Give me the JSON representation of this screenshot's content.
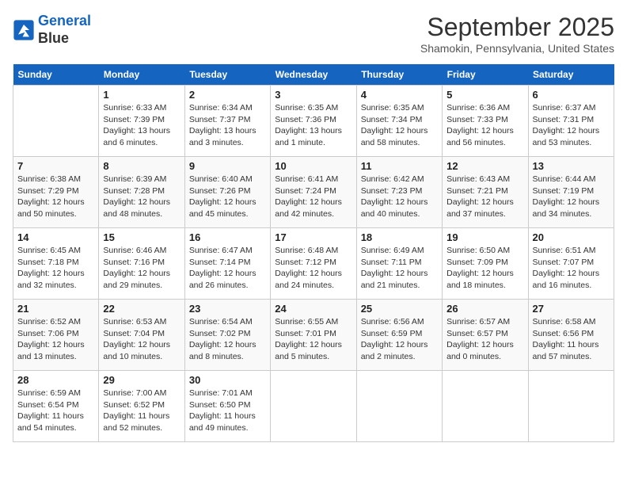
{
  "logo": {
    "line1": "General",
    "line2": "Blue"
  },
  "title": "September 2025",
  "subtitle": "Shamokin, Pennsylvania, United States",
  "days_of_week": [
    "Sunday",
    "Monday",
    "Tuesday",
    "Wednesday",
    "Thursday",
    "Friday",
    "Saturday"
  ],
  "weeks": [
    [
      {
        "day": "",
        "info": ""
      },
      {
        "day": "1",
        "info": "Sunrise: 6:33 AM\nSunset: 7:39 PM\nDaylight: 13 hours\nand 6 minutes."
      },
      {
        "day": "2",
        "info": "Sunrise: 6:34 AM\nSunset: 7:37 PM\nDaylight: 13 hours\nand 3 minutes."
      },
      {
        "day": "3",
        "info": "Sunrise: 6:35 AM\nSunset: 7:36 PM\nDaylight: 13 hours\nand 1 minute."
      },
      {
        "day": "4",
        "info": "Sunrise: 6:35 AM\nSunset: 7:34 PM\nDaylight: 12 hours\nand 58 minutes."
      },
      {
        "day": "5",
        "info": "Sunrise: 6:36 AM\nSunset: 7:33 PM\nDaylight: 12 hours\nand 56 minutes."
      },
      {
        "day": "6",
        "info": "Sunrise: 6:37 AM\nSunset: 7:31 PM\nDaylight: 12 hours\nand 53 minutes."
      }
    ],
    [
      {
        "day": "7",
        "info": "Sunrise: 6:38 AM\nSunset: 7:29 PM\nDaylight: 12 hours\nand 50 minutes."
      },
      {
        "day": "8",
        "info": "Sunrise: 6:39 AM\nSunset: 7:28 PM\nDaylight: 12 hours\nand 48 minutes."
      },
      {
        "day": "9",
        "info": "Sunrise: 6:40 AM\nSunset: 7:26 PM\nDaylight: 12 hours\nand 45 minutes."
      },
      {
        "day": "10",
        "info": "Sunrise: 6:41 AM\nSunset: 7:24 PM\nDaylight: 12 hours\nand 42 minutes."
      },
      {
        "day": "11",
        "info": "Sunrise: 6:42 AM\nSunset: 7:23 PM\nDaylight: 12 hours\nand 40 minutes."
      },
      {
        "day": "12",
        "info": "Sunrise: 6:43 AM\nSunset: 7:21 PM\nDaylight: 12 hours\nand 37 minutes."
      },
      {
        "day": "13",
        "info": "Sunrise: 6:44 AM\nSunset: 7:19 PM\nDaylight: 12 hours\nand 34 minutes."
      }
    ],
    [
      {
        "day": "14",
        "info": "Sunrise: 6:45 AM\nSunset: 7:18 PM\nDaylight: 12 hours\nand 32 minutes."
      },
      {
        "day": "15",
        "info": "Sunrise: 6:46 AM\nSunset: 7:16 PM\nDaylight: 12 hours\nand 29 minutes."
      },
      {
        "day": "16",
        "info": "Sunrise: 6:47 AM\nSunset: 7:14 PM\nDaylight: 12 hours\nand 26 minutes."
      },
      {
        "day": "17",
        "info": "Sunrise: 6:48 AM\nSunset: 7:12 PM\nDaylight: 12 hours\nand 24 minutes."
      },
      {
        "day": "18",
        "info": "Sunrise: 6:49 AM\nSunset: 7:11 PM\nDaylight: 12 hours\nand 21 minutes."
      },
      {
        "day": "19",
        "info": "Sunrise: 6:50 AM\nSunset: 7:09 PM\nDaylight: 12 hours\nand 18 minutes."
      },
      {
        "day": "20",
        "info": "Sunrise: 6:51 AM\nSunset: 7:07 PM\nDaylight: 12 hours\nand 16 minutes."
      }
    ],
    [
      {
        "day": "21",
        "info": "Sunrise: 6:52 AM\nSunset: 7:06 PM\nDaylight: 12 hours\nand 13 minutes."
      },
      {
        "day": "22",
        "info": "Sunrise: 6:53 AM\nSunset: 7:04 PM\nDaylight: 12 hours\nand 10 minutes."
      },
      {
        "day": "23",
        "info": "Sunrise: 6:54 AM\nSunset: 7:02 PM\nDaylight: 12 hours\nand 8 minutes."
      },
      {
        "day": "24",
        "info": "Sunrise: 6:55 AM\nSunset: 7:01 PM\nDaylight: 12 hours\nand 5 minutes."
      },
      {
        "day": "25",
        "info": "Sunrise: 6:56 AM\nSunset: 6:59 PM\nDaylight: 12 hours\nand 2 minutes."
      },
      {
        "day": "26",
        "info": "Sunrise: 6:57 AM\nSunset: 6:57 PM\nDaylight: 12 hours\nand 0 minutes."
      },
      {
        "day": "27",
        "info": "Sunrise: 6:58 AM\nSunset: 6:56 PM\nDaylight: 11 hours\nand 57 minutes."
      }
    ],
    [
      {
        "day": "28",
        "info": "Sunrise: 6:59 AM\nSunset: 6:54 PM\nDaylight: 11 hours\nand 54 minutes."
      },
      {
        "day": "29",
        "info": "Sunrise: 7:00 AM\nSunset: 6:52 PM\nDaylight: 11 hours\nand 52 minutes."
      },
      {
        "day": "30",
        "info": "Sunrise: 7:01 AM\nSunset: 6:50 PM\nDaylight: 11 hours\nand 49 minutes."
      },
      {
        "day": "",
        "info": ""
      },
      {
        "day": "",
        "info": ""
      },
      {
        "day": "",
        "info": ""
      },
      {
        "day": "",
        "info": ""
      }
    ]
  ]
}
